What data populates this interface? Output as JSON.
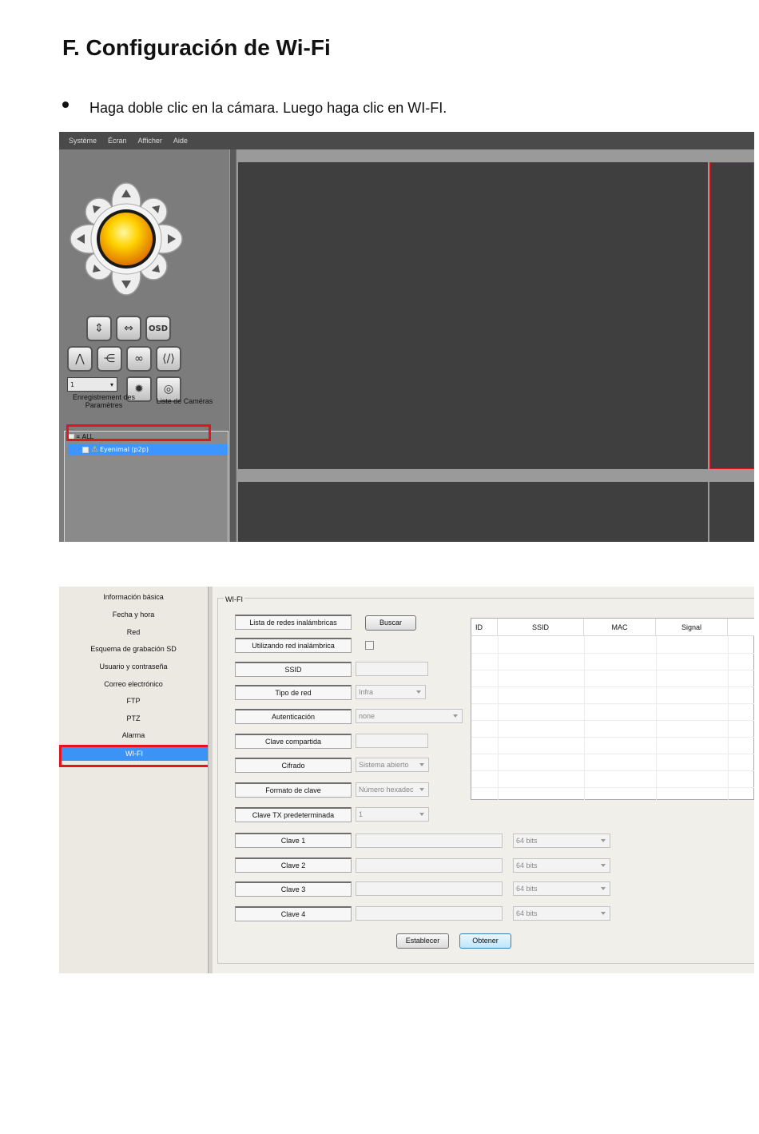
{
  "page": {
    "section_title": "F. Configuración de Wi-Fi",
    "bullet_text": "Haga doble clic en la cámara. Luego haga clic en WI-FI."
  },
  "screenshot1": {
    "menu": [
      "Système",
      "Écran",
      "Afficher",
      "Aide"
    ],
    "toolbar_row1": [
      "vertical-flip",
      "horizontal-flip",
      "OSD"
    ],
    "toolbar_row2": [
      "zoom",
      "focus",
      "link",
      "code"
    ],
    "channel_value": "1",
    "tab_parameters": "Enregistrement des Paramètres",
    "tab_cameras": "Liste de Caméras",
    "tree_root": "ALL",
    "tree_camera": "Eyenimal (p2p)",
    "colors": {
      "highlight": "#e3141b",
      "selection": "#3f95ff"
    }
  },
  "screenshot2": {
    "nav": [
      "Información básica",
      "Fecha y hora",
      "Red",
      "Esquema de grabación SD",
      "Usuario y contraseña",
      "Correo electrónico",
      "FTP",
      "PTZ",
      "Alarma",
      "WI-FI"
    ],
    "group_title": "WI-FI",
    "fields": {
      "wireless_list": "Lista de redes inalámbricas",
      "search_button": "Buscar",
      "using_wireless": "Utilizando red inalámbrica",
      "ssid": "SSID",
      "network_type": "Tipo de red",
      "network_type_value": "Infra",
      "authentication": "Autenticación",
      "authentication_value": "none",
      "shared_key": "Clave compartida",
      "encryption": "Cifrado",
      "encryption_value": "Sistema abierto",
      "key_format": "Formato de clave",
      "key_format_value": "Número hexadec",
      "default_tx_key": "Clave TX predeterminada",
      "default_tx_key_value": "1",
      "key1": "Clave 1",
      "key2": "Clave 2",
      "key3": "Clave 3",
      "key4": "Clave 4",
      "bits_value": "64 bits"
    },
    "table_headers": [
      "ID",
      "SSID",
      "MAC",
      "Signal"
    ],
    "buttons": {
      "set": "Establecer",
      "get": "Obtener"
    }
  }
}
